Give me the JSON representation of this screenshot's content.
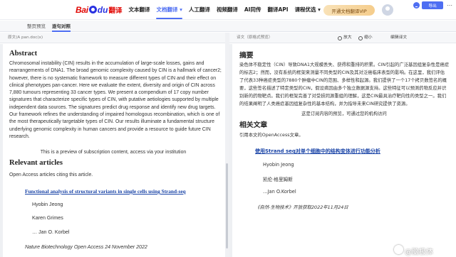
{
  "header": {
    "logo_text_bai": "Bai",
    "logo_text_du": "du",
    "logo_text_fy": "翻译",
    "nav": [
      "文本翻译",
      "文档翻译 ▾",
      "人工翻译",
      "视频翻译",
      "AI同传",
      "翻译API",
      "课程优选 ▾",
      "官网"
    ],
    "active_nav_index": 1,
    "vip_button": "开通文档翻译VIP"
  },
  "tabs": [
    "整页预览",
    "逐句对照"
  ],
  "active_tab_index": 1,
  "left_panel": {
    "file_label": "原文(A pan.doc(x)"
  },
  "right_panel": {
    "file_label": "译文（原格式预览）",
    "tools": {
      "zoom_in": "放大",
      "zoom_out": "缩小",
      "edit": "编辑译文"
    },
    "export_button": "导出"
  },
  "source": {
    "abstract_heading": "Abstract",
    "abstract_lines": [
      "Chromosomal instability (CIN) results in the accumulation of large-scale losses, gains and",
      "rearrangements of DNA1. The broad genomic complexity caused by CIN is a hallmark of cancer2;",
      "however, there is no systematic framework to measure different types of CIN and their effect on",
      "clinical phenotypes pan-cancer. Here we evaluate the extent, diversity and origin of CIN across",
      "7,880 tumours representing 33 cancer types. We present a compendium of 17 copy number",
      "signatures that characterize specific types of CIN, with putative aetiologies supported by multiple",
      "independent data sources. The signatures predict drug response and identify new drug targets.",
      "Our framework refines the understanding of impaired homologous recombination, which is one of",
      "the most therapeutically targetable types of CIN. Our results illuminate a fundamental structure",
      "underlying genomic complexity in human cancers and provide a resource to guide future CIN",
      "research."
    ],
    "preview_note": "This is a preview of subscription content, access via your institution",
    "relevant_heading": "Relevant articles",
    "relevant_intro": "Open Access articles citing this article.",
    "article_title": "Functional analysis of structural variants in single cells using Strand-seq",
    "authors": [
      "Hyobin Jeong",
      "Karen Grimes",
      "… Jan O. Korbel"
    ],
    "journal": "Nature Biotechnology Open Access 24 November 2022"
  },
  "translation": {
    "abstract_heading": "摘要",
    "abstract_lines": [
      "染色体不稳定性（CIN）导致DNA1大规模丢失、获得和重排的积累。CIN引起的广泛基因组复杂性是癌症",
      "的标志2；然而，没有系统的框架来测量不同类型的CIN及其对泛癌临床表型的影响。在这里，我们评估",
      "了代表33种癌症类型的7880个肿瘤中CIN的范围、多样性和起源。我们提供了一个17个拷贝数签名的概",
      "要，这些签名描述了特定类型的CIN，假设病因由多个独立数据源支持。这些特征可以预测药物反应并识",
      "别新的药物靶点。我们的框架完善了对受损同源重组的理解，这是CIN最具治疗靶向性的类型之一。我们",
      "的结果阐明了人类癌症基因组复杂性的基本结构，并为指导未来CIN研究提供了资源。"
    ],
    "preview_note": "这是订阅内容的预览，可通过您的机构访问",
    "relevant_heading": "相关文章",
    "relevant_intro": "引用本文的OpenAccess文章。",
    "article_title": "使用Strand seq对单个细胞中的结构变体进行功能分析",
    "authors": [
      "Hyobin Jeong",
      "凯伦·格里姆斯",
      "…Jan O.Korbel"
    ],
    "journal": "《自然-生物技术》开放获取2022年11月24日"
  },
  "watermark": "@脑极体",
  "colors": {
    "accent": "#4e6ef2",
    "link": "#1a44a7",
    "brand_red": "#e10602"
  }
}
